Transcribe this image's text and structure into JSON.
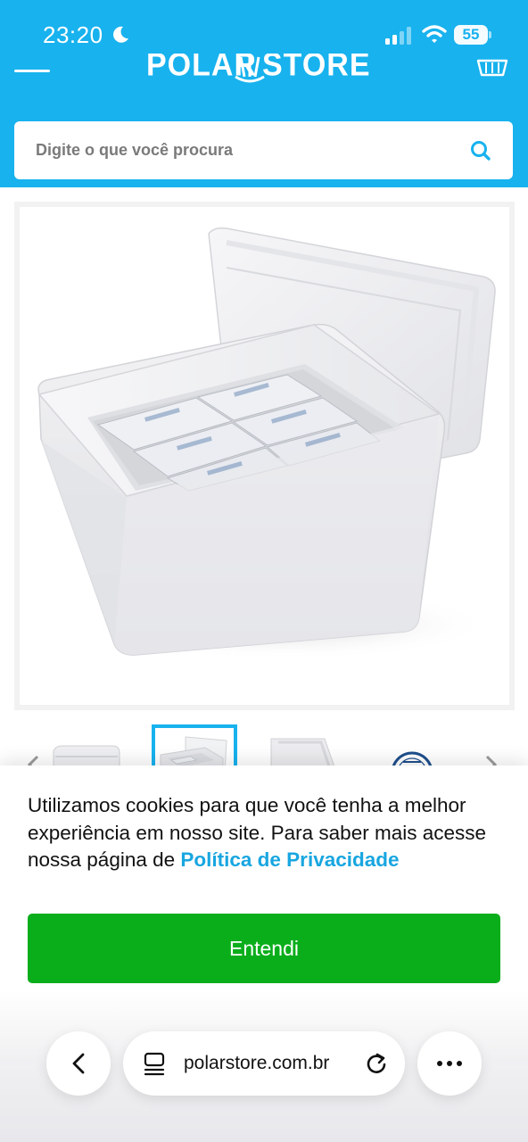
{
  "status_bar": {
    "time": "23:20",
    "battery": "55",
    "battery_level": 0.55
  },
  "header": {
    "logo_left": "POLAR",
    "logo_right": "STORE",
    "search_placeholder": "Digite o que você procura"
  },
  "product": {
    "thumbnail_count": 4,
    "selected_thumbnail": 2
  },
  "cookie_banner": {
    "text": "Utilizamos cookies para que você tenha a melhor experiência em nosso site. Para saber mais acesse nossa página de ",
    "link_text": "Política de Privacidade",
    "accept_label": "Entendi"
  },
  "browser": {
    "url": "polarstore.com.br"
  },
  "colors": {
    "brand_blue": "#18b2ee",
    "accept_green": "#0aae1b",
    "link_blue": "#18a6e0"
  },
  "icons": [
    "moon-icon",
    "cellular-signal-icon",
    "wifi-icon",
    "battery-icon",
    "menu-icon",
    "cart-icon",
    "search-icon",
    "chevron-left-icon",
    "chevron-right-icon",
    "back-icon",
    "tabs-icon",
    "reload-icon",
    "more-icon"
  ]
}
